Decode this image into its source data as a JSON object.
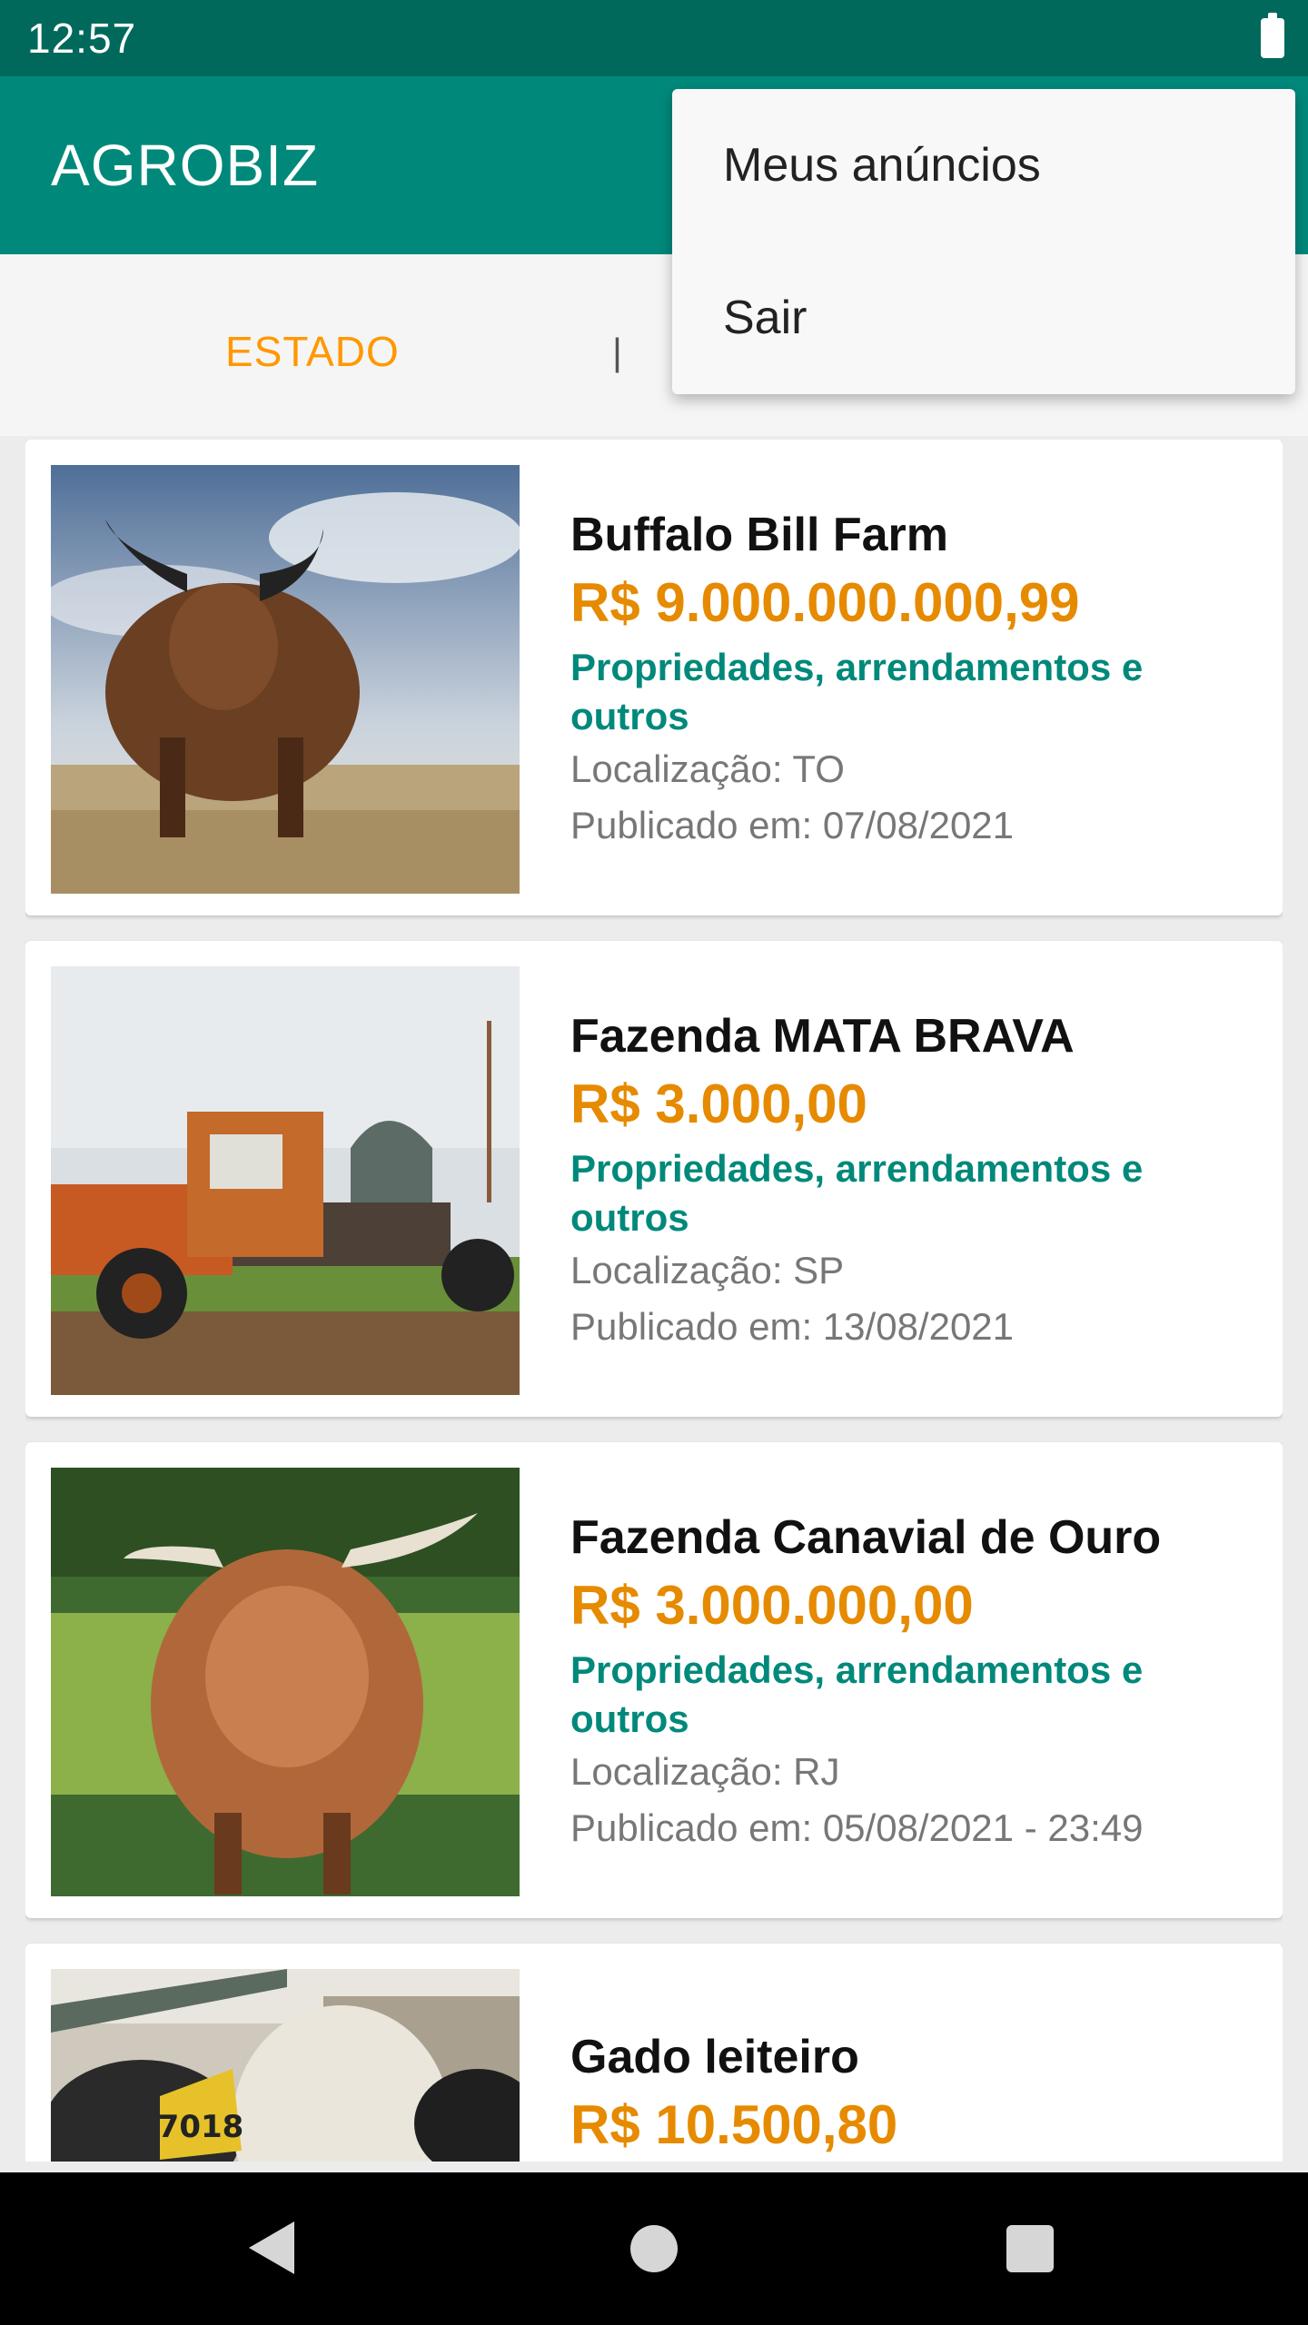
{
  "status_bar": {
    "time": "12:57"
  },
  "app_bar": {
    "title": "AGROBIZ"
  },
  "filters": {
    "estado_label": "ESTADO",
    "separator": "|"
  },
  "menu": {
    "items": [
      {
        "label": "Meus anúncios"
      },
      {
        "label": "Sair"
      }
    ]
  },
  "listings": [
    {
      "title": "Buffalo Bill Farm",
      "price": "R$ 9.000.000.000,99",
      "category": "Propriedades, arrendamentos e outros",
      "location": "Localização: TO",
      "published": "Publicado em: 07/08/2021",
      "image": "highland-bull-sky-photo"
    },
    {
      "title": "Fazenda MATA BRAVA",
      "price": "R$ 3.000,00",
      "category": "Propriedades, arrendamentos e outros",
      "location": "Localização: SP",
      "published": "Publicado em: 13/08/2021",
      "image": "rusty-truck-photo"
    },
    {
      "title": "Fazenda Canavial de Ouro",
      "price": "R$ 3.000.000,00",
      "category": "Propriedades, arrendamentos e outros",
      "location": "Localização: RJ",
      "published": "Publicado em: 05/08/2021 - 23:49",
      "image": "highland-cow-meadow-photo"
    },
    {
      "title": "Gado leiteiro",
      "price": "R$ 10.500,80",
      "category": "",
      "location": "",
      "published": "",
      "image": "dairy-cow-photo",
      "ear_tag": "7018"
    }
  ],
  "colors": {
    "status_bar": "#00695c",
    "app_bar": "#00897b",
    "accent": "#ff9800",
    "price": "#e68a00",
    "category": "#00897b"
  },
  "nav_bar": {
    "icons": [
      "back-icon",
      "home-icon",
      "recents-icon"
    ]
  }
}
